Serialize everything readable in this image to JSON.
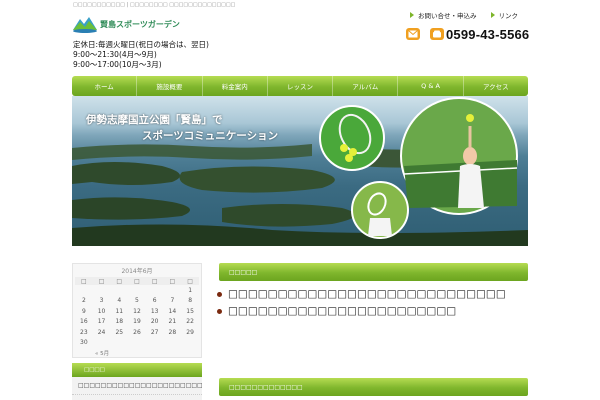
{
  "header": {
    "tagline": "□□□□□□□□□□□ | □□□□□□□□ □□□□□□□□□□□□□□",
    "site_name": "賢島スポーツガーデン",
    "hours": [
      "定休日:毎週火曜日(祝日の場合は、翌日)",
      "9:00〜21:30(4月〜9月)",
      "9:00〜17:00(10月〜3月)"
    ],
    "links": [
      {
        "label": "お問い合せ・申込み"
      },
      {
        "label": "リンク"
      }
    ],
    "phone": "0599-43-5566",
    "icons": {
      "mail": "mail-icon",
      "phone": "phone-icon"
    }
  },
  "nav": {
    "items": [
      {
        "label": "ホーム"
      },
      {
        "label": "施設概要"
      },
      {
        "label": "料金案内"
      },
      {
        "label": "レッスン"
      },
      {
        "label": "アルバム"
      },
      {
        "label": "Q & A"
      },
      {
        "label": "アクセス"
      }
    ]
  },
  "hero": {
    "title": "伊勢志摩国立公園「賢島」で",
    "subtitle": "スポーツコミュニケーション"
  },
  "calendar": {
    "title": "2014年6月",
    "weekdays": [
      "□",
      "□",
      "□",
      "□",
      "□",
      "□",
      "□"
    ],
    "weeks": [
      [
        "",
        "",
        "",
        "",
        "",
        "",
        "1"
      ],
      [
        "2",
        "3",
        "4",
        "5",
        "6",
        "7",
        "8"
      ],
      [
        "9",
        "10",
        "11",
        "12",
        "13",
        "14",
        "15"
      ],
      [
        "16",
        "17",
        "18",
        "19",
        "20",
        "21",
        "22"
      ],
      [
        "23",
        "24",
        "25",
        "26",
        "27",
        "28",
        "29"
      ],
      [
        "30",
        "",
        "",
        "",
        "",
        "",
        ""
      ]
    ],
    "prev_label": "« 5月"
  },
  "sidebar": {
    "heading": "□□□□",
    "item": "□□□□□□□□□□□□□□□□□□□□□□□□□□"
  },
  "main": {
    "news_heading": "□□□□□",
    "news": [
      {
        "text": "□□□□□□□□□□□□□□□□□□□□□□□□□□□□"
      },
      {
        "text": "□□□□□□□□□□□□□□□□□□□□□□□"
      }
    ],
    "second_heading": "□□□□□□□□□□□□□"
  },
  "colors": {
    "accent_green": "#7fb62d",
    "icon_orange": "#f0a020",
    "logo_green": "#2e8b57"
  }
}
